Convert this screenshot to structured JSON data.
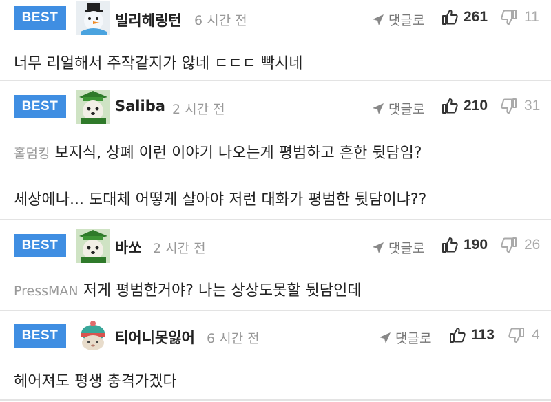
{
  "comments": [
    {
      "badge": "BEST",
      "avatar": "snowman-avatar",
      "nickname": "빌리헤링턴",
      "time": "6 시간 전",
      "reply_label": "댓글로",
      "likes": "261",
      "dislikes": "11",
      "mention": "",
      "lines": [
        "너무 리얼해서 주작같지가 않네 ㄷㄷㄷ 빡시네"
      ]
    },
    {
      "badge": "BEST",
      "avatar": "dog-avatar",
      "nickname": "Saliba",
      "time": "2 시간 전",
      "reply_label": "댓글로",
      "likes": "210",
      "dislikes": "31",
      "mention": "홀덤킹",
      "lines": [
        "보지식, 상폐 이런 이야기 나오는게 평범하고 흔한 뒷담임?",
        "세상에나... 도대체 어떻게 살아야 저런 대화가 평범한 뒷담이냐??"
      ]
    },
    {
      "badge": "BEST",
      "avatar": "dog-avatar",
      "nickname": "바쏘",
      "time": "2 시간 전",
      "reply_label": "댓글로",
      "likes": "190",
      "dislikes": "26",
      "mention": "PressMAN",
      "lines": [
        "저게 평범한거야? 나는 상상도못할 뒷담인데"
      ]
    },
    {
      "badge": "BEST",
      "avatar": "knit-hat-avatar",
      "nickname": "티어니못잃어",
      "time": "6 시간 전",
      "reply_label": "댓글로",
      "likes": "113",
      "dislikes": "4",
      "mention": "",
      "lines": [
        "헤어져도 평생 충격가겠다"
      ]
    }
  ],
  "colors": {
    "badge": "#3f8ee2",
    "meta": "#999999",
    "divider": "#e3e3e3"
  },
  "icons": {
    "reply": "reply-arrow-icon",
    "like": "thumbs-up-icon",
    "dislike": "thumbs-down-icon"
  }
}
